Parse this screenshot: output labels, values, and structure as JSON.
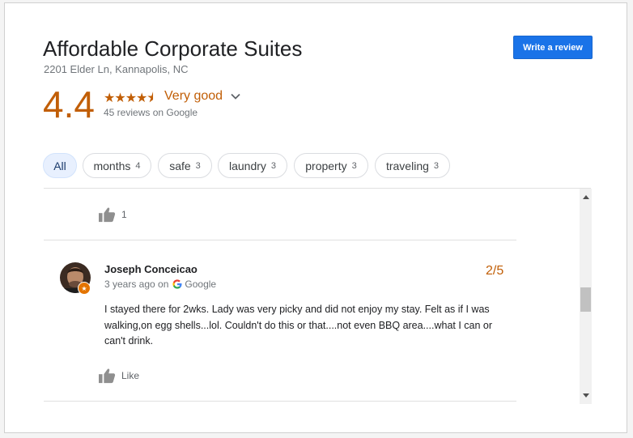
{
  "place": {
    "name": "Affordable Corporate Suites",
    "address": "2201 Elder Ln, Kannapolis, NC",
    "write_review_label": "Write a review"
  },
  "rating": {
    "value": "4.4",
    "stars_glyphs": "★★★★⯨",
    "stars_value": 4.4,
    "label": "Very good",
    "reviews_count": "45 reviews on Google"
  },
  "filters": [
    {
      "label": "All",
      "count": "",
      "active": true
    },
    {
      "label": "months",
      "count": "4"
    },
    {
      "label": "safe",
      "count": "3"
    },
    {
      "label": "laundry",
      "count": "3"
    },
    {
      "label": "property",
      "count": "3"
    },
    {
      "label": "traveling",
      "count": "3"
    }
  ],
  "reviews": [
    {
      "like_label": "1"
    },
    {
      "author": "Joseph Conceicao",
      "time": "3 years ago on",
      "source": "Google",
      "score": "2/5",
      "text": "I stayed there for 2wks. Lady was very picky and did not enjoy my stay. Felt as if I was walking,on egg shells...lol. Couldn't do this or that....not even BBQ area....what I can or can't drink.",
      "like_label": "Like"
    }
  ],
  "colors": {
    "accent": "#1a73e8",
    "rating": "#c15e06",
    "muted": "#70757a"
  },
  "icons": {
    "dropdown": "chevron-down-icon",
    "like": "thumbs-up-icon",
    "google": "google-g-icon",
    "badge": "local-guide-star-icon"
  }
}
